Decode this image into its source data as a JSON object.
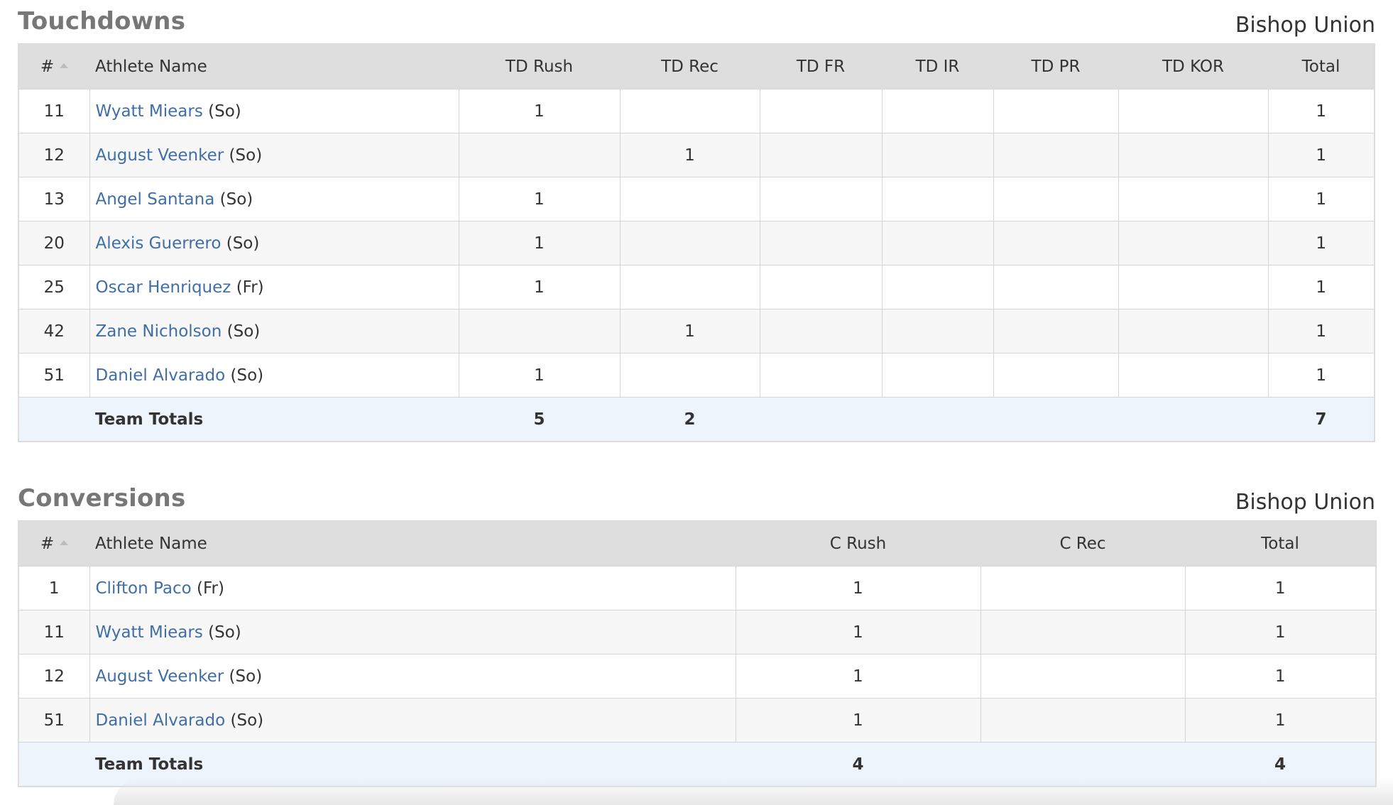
{
  "touchdowns": {
    "title": "Touchdowns",
    "team": "Bishop Union",
    "columns": [
      "#",
      "Athlete Name",
      "TD Rush",
      "TD Rec",
      "TD FR",
      "TD IR",
      "TD PR",
      "TD KOR",
      "Total"
    ],
    "rows": [
      {
        "num": "11",
        "name": "Wyatt Miears",
        "year": "(So)",
        "vals": [
          "1",
          "",
          "",
          "",
          "",
          ""
        ],
        "total": "1"
      },
      {
        "num": "12",
        "name": "August Veenker",
        "year": "(So)",
        "vals": [
          "",
          "1",
          "",
          "",
          "",
          ""
        ],
        "total": "1"
      },
      {
        "num": "13",
        "name": "Angel Santana",
        "year": "(So)",
        "vals": [
          "1",
          "",
          "",
          "",
          "",
          ""
        ],
        "total": "1"
      },
      {
        "num": "20",
        "name": "Alexis Guerrero",
        "year": "(So)",
        "vals": [
          "1",
          "",
          "",
          "",
          "",
          ""
        ],
        "total": "1"
      },
      {
        "num": "25",
        "name": "Oscar Henriquez",
        "year": "(Fr)",
        "vals": [
          "1",
          "",
          "",
          "",
          "",
          ""
        ],
        "total": "1"
      },
      {
        "num": "42",
        "name": "Zane Nicholson",
        "year": "(So)",
        "vals": [
          "",
          "1",
          "",
          "",
          "",
          ""
        ],
        "total": "1"
      },
      {
        "num": "51",
        "name": "Daniel Alvarado",
        "year": "(So)",
        "vals": [
          "1",
          "",
          "",
          "",
          "",
          ""
        ],
        "total": "1"
      }
    ],
    "totals": {
      "label": "Team Totals",
      "vals": [
        "5",
        "2",
        "",
        "",
        "",
        ""
      ],
      "total": "7"
    }
  },
  "conversions": {
    "title": "Conversions",
    "team": "Bishop Union",
    "columns": [
      "#",
      "Athlete Name",
      "C Rush",
      "C Rec",
      "Total"
    ],
    "rows": [
      {
        "num": "1",
        "name": "Clifton Paco",
        "year": "(Fr)",
        "vals": [
          "1",
          ""
        ],
        "total": "1"
      },
      {
        "num": "11",
        "name": "Wyatt Miears",
        "year": "(So)",
        "vals": [
          "1",
          ""
        ],
        "total": "1"
      },
      {
        "num": "12",
        "name": "August Veenker",
        "year": "(So)",
        "vals": [
          "1",
          ""
        ],
        "total": "1"
      },
      {
        "num": "51",
        "name": "Daniel Alvarado",
        "year": "(So)",
        "vals": [
          "1",
          ""
        ],
        "total": "1"
      }
    ],
    "totals": {
      "label": "Team Totals",
      "vals": [
        "4",
        ""
      ],
      "total": "4"
    }
  },
  "colors": {
    "link": "#3f6ea8",
    "header_bg": "#dedede",
    "totals_bg": "#eef4fb",
    "title": "#777777"
  },
  "icons": {
    "sort": "sort-up-caret-icon"
  }
}
